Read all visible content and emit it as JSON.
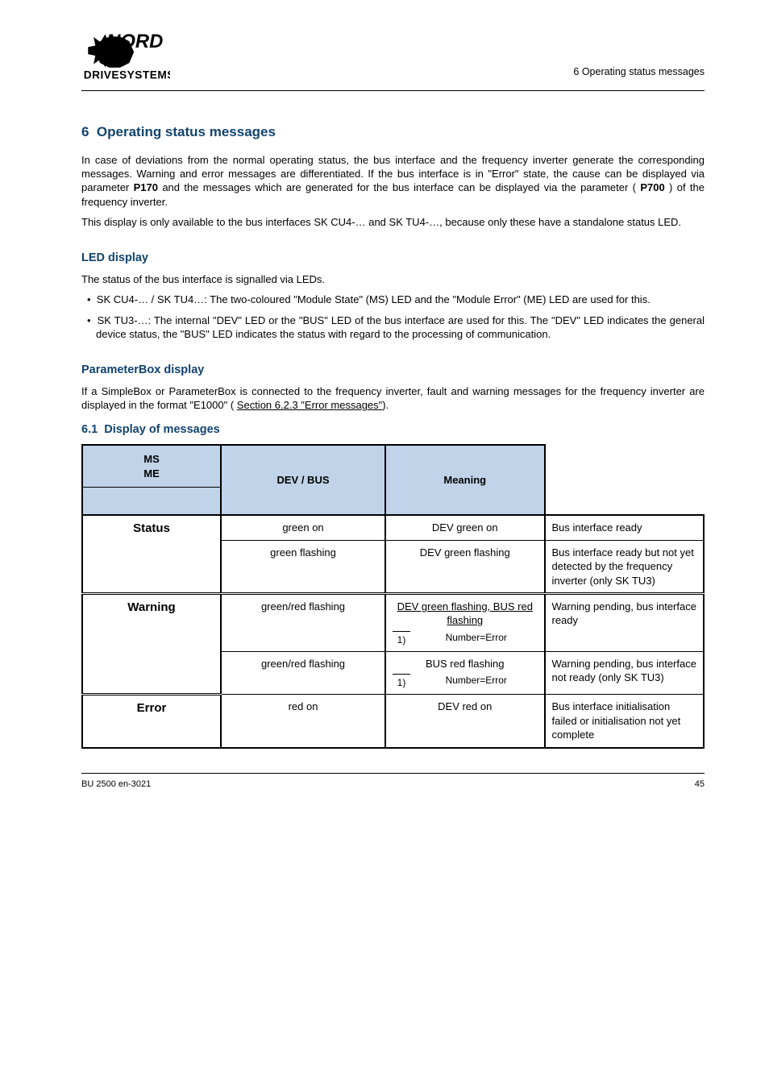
{
  "header": {
    "logo_top": "NORD",
    "logo_bottom": "DRIVESYSTEMS",
    "right": "6 Operating status messages"
  },
  "section": {
    "number": "6",
    "title": "Operating status messages",
    "sub_number": "6.1",
    "sub_title": "Display of messages"
  },
  "para": {
    "p1": "In case of deviations from the normal operating status, the bus interface and the frequency inverter generate the corresponding messages. Warning and error messages are differentiated. If the bus interface is in \"Error\" state, the cause can be displayed via parameter",
    "p1b": " and the messages which are generated for the bus interface can be displayed via the parameter (",
    "p1c": ") of the frequency inverter.",
    "p1_bold": "P170",
    "p1_bold2": "P700",
    "p2": "This display is only available to the bus interfaces SK CU4-… and SK TU4-…, because only these have a standalone status LED.",
    "led": "LED display",
    "led_p1": "The status of the bus interface is signalled via LEDs.",
    "led_li1": "SK CU4-… / SK TU4…: The two-coloured \"Module State\" (MS) LED and the \"Module Error\" (ME) LED are used for this.",
    "led_li2": "SK TU3-…: The internal \"DEV\" LED or the \"BUS\" LED of the bus interface are used for this. The \"DEV\" LED indicates the general device status, the \"BUS\" LED indicates the status with regard to the processing of communication.",
    "pbox": "ParameterBox display",
    "pbox_p": "If a SimpleBox or ParameterBox is connected to the frequency inverter, fault and warning messages for the frequency inverter are displayed in the format \"E1000\" (",
    "pbox_p_link": "Section 6.2.3 \"Error messages\""
  },
  "table": {
    "hdr_ms": "MS",
    "hdr_me": "ME",
    "hdr_dev_bus": "DEV / BUS",
    "hdr_meaning": "Meaning",
    "group_status": "Status",
    "group_warning": "Warning",
    "group_error": "Error",
    "r1_msme": "green on",
    "r1_dev": "DEV green on",
    "r1_m": "Bus interface ready",
    "r2_msme": "green flashing",
    "r2_dev": "DEV green flashing",
    "r2_m": "Bus interface ready but not yet detected by the frequency inverter (only SK TU3)",
    "r3_msme": "green/red flashing",
    "r3_dev": "DEV green flashing, BUS red flashing",
    "r3_n1": "1)",
    "r3_t1": "Number=Error",
    "r3_m": "Warning pending, bus interface ready",
    "r4_msme": "green/red flashing",
    "r4_dev": "BUS red flashing",
    "r4_n1": "1)",
    "r4_t1": "Number=Error",
    "r4_m": "Warning pending, bus interface not ready (only SK TU3)",
    "r5_msme": "red on",
    "r5_dev": "DEV red on",
    "r5_m": "Bus interface initialisation failed or initialisation not yet complete"
  },
  "footer": {
    "left": "BU 2500 en-3021",
    "right": "45"
  }
}
